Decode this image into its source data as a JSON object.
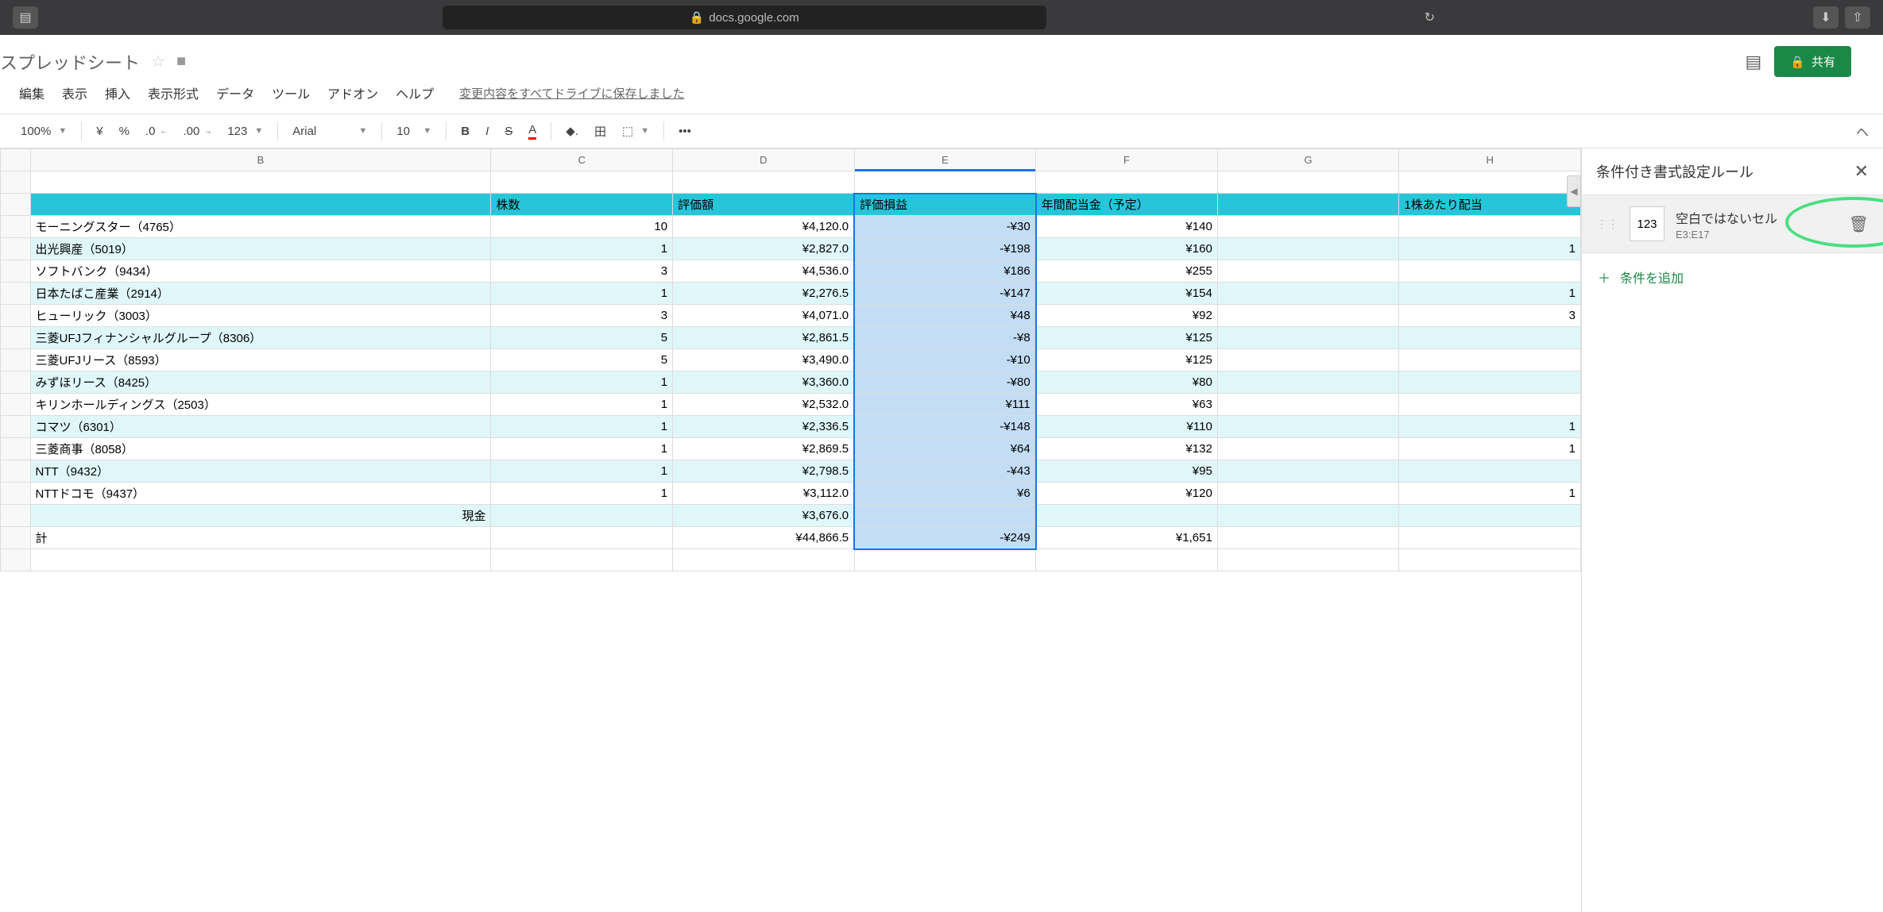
{
  "safari": {
    "url": "docs.google.com"
  },
  "doc": {
    "title": "スプレッドシート"
  },
  "menu": [
    "編集",
    "表示",
    "挿入",
    "表示形式",
    "データ",
    "ツール",
    "アドオン",
    "ヘルプ"
  ],
  "saveStatus": "変更内容をすべてドライブに保存しました",
  "toolbar": {
    "zoom": "100%",
    "yen": "¥",
    "pct": "%",
    "dec1": ".0",
    "dec2": ".00",
    "fmt": "123",
    "font": "Arial",
    "size": "10"
  },
  "share": "共有",
  "columns": [
    "B",
    "C",
    "D",
    "E",
    "F",
    "G",
    "H"
  ],
  "headers": {
    "C": "株数",
    "D": "評価額",
    "E": "評価損益",
    "F": "年間配当金（予定）",
    "H": "1株あたり配当"
  },
  "rows": [
    {
      "B": "モーニングスター（4765）",
      "C": "10",
      "D": "¥4,120.0",
      "E": "-¥30",
      "F": "¥140",
      "H": ""
    },
    {
      "B": "出光興産（5019）",
      "C": "1",
      "D": "¥2,827.0",
      "E": "-¥198",
      "F": "¥160",
      "H": "1"
    },
    {
      "B": "ソフトバンク（9434）",
      "C": "3",
      "D": "¥4,536.0",
      "E": "¥186",
      "F": "¥255",
      "H": ""
    },
    {
      "B": "日本たばこ産業（2914）",
      "C": "1",
      "D": "¥2,276.5",
      "E": "-¥147",
      "F": "¥154",
      "H": "1"
    },
    {
      "B": "ヒューリック（3003）",
      "C": "3",
      "D": "¥4,071.0",
      "E": "¥48",
      "F": "¥92",
      "H": "3"
    },
    {
      "B": "三菱UFJフィナンシャルグループ（8306）",
      "C": "5",
      "D": "¥2,861.5",
      "E": "-¥8",
      "F": "¥125",
      "H": ""
    },
    {
      "B": "三菱UFJリース（8593）",
      "C": "5",
      "D": "¥3,490.0",
      "E": "-¥10",
      "F": "¥125",
      "H": ""
    },
    {
      "B": "みずほリース（8425）",
      "C": "1",
      "D": "¥3,360.0",
      "E": "-¥80",
      "F": "¥80",
      "H": ""
    },
    {
      "B": "キリンホールディングス（2503）",
      "C": "1",
      "D": "¥2,532.0",
      "E": "¥111",
      "F": "¥63",
      "H": ""
    },
    {
      "B": "コマツ（6301）",
      "C": "1",
      "D": "¥2,336.5",
      "E": "-¥148",
      "F": "¥110",
      "H": "1"
    },
    {
      "B": "三菱商事（8058）",
      "C": "1",
      "D": "¥2,869.5",
      "E": "¥64",
      "F": "¥132",
      "H": "1"
    },
    {
      "B": "NTT（9432）",
      "C": "1",
      "D": "¥2,798.5",
      "E": "-¥43",
      "F": "¥95",
      "H": ""
    },
    {
      "B": "NTTドコモ（9437）",
      "C": "1",
      "D": "¥3,112.0",
      "E": "¥6",
      "F": "¥120",
      "H": "1"
    }
  ],
  "cashRow": {
    "B": "現金",
    "D": "¥3,676.0"
  },
  "totalRow": {
    "B": "計",
    "D": "¥44,866.5",
    "E": "-¥249",
    "F": "¥1,651"
  },
  "sidebar": {
    "title": "条件付き書式設定ルール",
    "ruleBox": "123",
    "ruleName": "空白ではないセル",
    "ruleRange": "E3:E17",
    "addRule": "条件を追加"
  }
}
